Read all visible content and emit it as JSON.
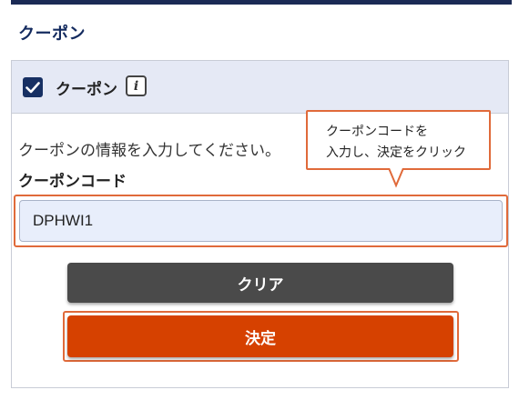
{
  "page_title": "クーポン",
  "panel": {
    "header_label": "クーポン",
    "info_icon_glyph": "i",
    "description": "クーポンの情報を入力してください。",
    "code_label": "クーポンコード",
    "code_value": "DPHWI1",
    "clear_label": "クリア",
    "decide_label": "決定"
  },
  "tooltip": {
    "line1": "クーポンコードを",
    "line2": "入力し、決定をクリック"
  },
  "colors": {
    "navy": "#142b5f",
    "header_bg": "#e5e9f5",
    "input_bg": "#e8eefb",
    "clear_button": "#4a4a4a",
    "decide_button": "#d64100",
    "highlight": "#e06a3a"
  },
  "icons": {
    "checkbox": "checkmark-icon",
    "info": "info-icon"
  }
}
